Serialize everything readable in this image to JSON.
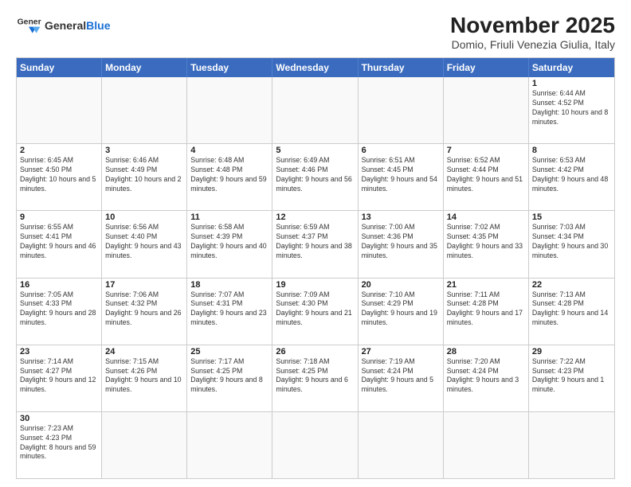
{
  "logo": {
    "text_general": "General",
    "text_blue": "Blue"
  },
  "title": "November 2025",
  "subtitle": "Domio, Friuli Venezia Giulia, Italy",
  "days_of_week": [
    "Sunday",
    "Monday",
    "Tuesday",
    "Wednesday",
    "Thursday",
    "Friday",
    "Saturday"
  ],
  "weeks": [
    [
      {
        "day": "",
        "info": ""
      },
      {
        "day": "",
        "info": ""
      },
      {
        "day": "",
        "info": ""
      },
      {
        "day": "",
        "info": ""
      },
      {
        "day": "",
        "info": ""
      },
      {
        "day": "",
        "info": ""
      },
      {
        "day": "1",
        "info": "Sunrise: 6:44 AM\nSunset: 4:52 PM\nDaylight: 10 hours and 8 minutes."
      }
    ],
    [
      {
        "day": "2",
        "info": "Sunrise: 6:45 AM\nSunset: 4:50 PM\nDaylight: 10 hours and 5 minutes."
      },
      {
        "day": "3",
        "info": "Sunrise: 6:46 AM\nSunset: 4:49 PM\nDaylight: 10 hours and 2 minutes."
      },
      {
        "day": "4",
        "info": "Sunrise: 6:48 AM\nSunset: 4:48 PM\nDaylight: 9 hours and 59 minutes."
      },
      {
        "day": "5",
        "info": "Sunrise: 6:49 AM\nSunset: 4:46 PM\nDaylight: 9 hours and 56 minutes."
      },
      {
        "day": "6",
        "info": "Sunrise: 6:51 AM\nSunset: 4:45 PM\nDaylight: 9 hours and 54 minutes."
      },
      {
        "day": "7",
        "info": "Sunrise: 6:52 AM\nSunset: 4:44 PM\nDaylight: 9 hours and 51 minutes."
      },
      {
        "day": "8",
        "info": "Sunrise: 6:53 AM\nSunset: 4:42 PM\nDaylight: 9 hours and 48 minutes."
      }
    ],
    [
      {
        "day": "9",
        "info": "Sunrise: 6:55 AM\nSunset: 4:41 PM\nDaylight: 9 hours and 46 minutes."
      },
      {
        "day": "10",
        "info": "Sunrise: 6:56 AM\nSunset: 4:40 PM\nDaylight: 9 hours and 43 minutes."
      },
      {
        "day": "11",
        "info": "Sunrise: 6:58 AM\nSunset: 4:39 PM\nDaylight: 9 hours and 40 minutes."
      },
      {
        "day": "12",
        "info": "Sunrise: 6:59 AM\nSunset: 4:37 PM\nDaylight: 9 hours and 38 minutes."
      },
      {
        "day": "13",
        "info": "Sunrise: 7:00 AM\nSunset: 4:36 PM\nDaylight: 9 hours and 35 minutes."
      },
      {
        "day": "14",
        "info": "Sunrise: 7:02 AM\nSunset: 4:35 PM\nDaylight: 9 hours and 33 minutes."
      },
      {
        "day": "15",
        "info": "Sunrise: 7:03 AM\nSunset: 4:34 PM\nDaylight: 9 hours and 30 minutes."
      }
    ],
    [
      {
        "day": "16",
        "info": "Sunrise: 7:05 AM\nSunset: 4:33 PM\nDaylight: 9 hours and 28 minutes."
      },
      {
        "day": "17",
        "info": "Sunrise: 7:06 AM\nSunset: 4:32 PM\nDaylight: 9 hours and 26 minutes."
      },
      {
        "day": "18",
        "info": "Sunrise: 7:07 AM\nSunset: 4:31 PM\nDaylight: 9 hours and 23 minutes."
      },
      {
        "day": "19",
        "info": "Sunrise: 7:09 AM\nSunset: 4:30 PM\nDaylight: 9 hours and 21 minutes."
      },
      {
        "day": "20",
        "info": "Sunrise: 7:10 AM\nSunset: 4:29 PM\nDaylight: 9 hours and 19 minutes."
      },
      {
        "day": "21",
        "info": "Sunrise: 7:11 AM\nSunset: 4:28 PM\nDaylight: 9 hours and 17 minutes."
      },
      {
        "day": "22",
        "info": "Sunrise: 7:13 AM\nSunset: 4:28 PM\nDaylight: 9 hours and 14 minutes."
      }
    ],
    [
      {
        "day": "23",
        "info": "Sunrise: 7:14 AM\nSunset: 4:27 PM\nDaylight: 9 hours and 12 minutes."
      },
      {
        "day": "24",
        "info": "Sunrise: 7:15 AM\nSunset: 4:26 PM\nDaylight: 9 hours and 10 minutes."
      },
      {
        "day": "25",
        "info": "Sunrise: 7:17 AM\nSunset: 4:25 PM\nDaylight: 9 hours and 8 minutes."
      },
      {
        "day": "26",
        "info": "Sunrise: 7:18 AM\nSunset: 4:25 PM\nDaylight: 9 hours and 6 minutes."
      },
      {
        "day": "27",
        "info": "Sunrise: 7:19 AM\nSunset: 4:24 PM\nDaylight: 9 hours and 5 minutes."
      },
      {
        "day": "28",
        "info": "Sunrise: 7:20 AM\nSunset: 4:24 PM\nDaylight: 9 hours and 3 minutes."
      },
      {
        "day": "29",
        "info": "Sunrise: 7:22 AM\nSunset: 4:23 PM\nDaylight: 9 hours and 1 minute."
      }
    ],
    [
      {
        "day": "30",
        "info": "Sunrise: 7:23 AM\nSunset: 4:23 PM\nDaylight: 8 hours and 59 minutes."
      },
      {
        "day": "",
        "info": ""
      },
      {
        "day": "",
        "info": ""
      },
      {
        "day": "",
        "info": ""
      },
      {
        "day": "",
        "info": ""
      },
      {
        "day": "",
        "info": ""
      },
      {
        "day": "",
        "info": ""
      }
    ]
  ]
}
